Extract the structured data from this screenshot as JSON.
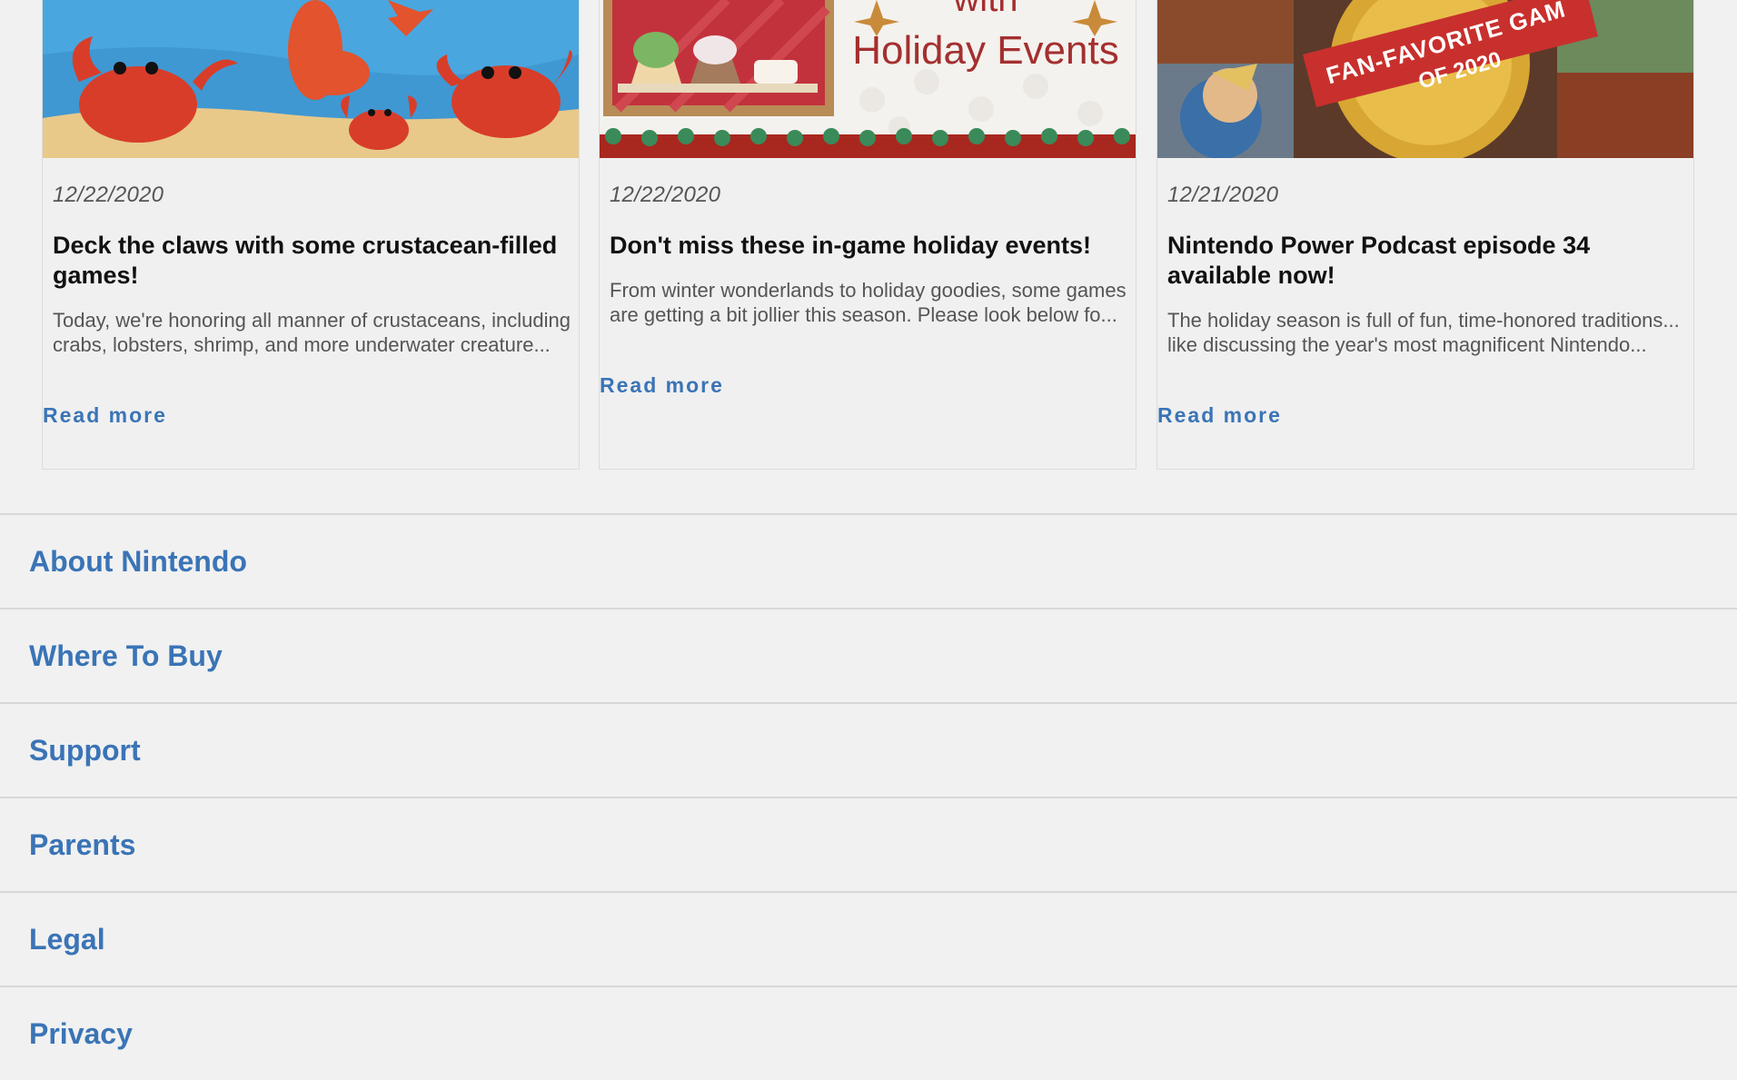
{
  "cards": [
    {
      "date": "12/22/2020",
      "title": "Deck the claws with some crustacean-filled games!",
      "description": "Today, we're honoring all manner of crustaceans, including crabs, lobsters, shrimp, and more underwater creature...",
      "read_more": "Read more"
    },
    {
      "date": "12/22/2020",
      "title": "Don't miss these in-game holiday events!",
      "description": "From winter wonderlands to holiday goodies, some games are getting a bit jollier this season. Please look below fo...",
      "read_more": "Read more",
      "image_text": [
        "with",
        "Holiday Events"
      ]
    },
    {
      "date": "12/21/2020",
      "title": "Nintendo Power Podcast episode 34 available now!",
      "description": "The holiday season is full of fun, time-honored traditions... like discussing the year's most magnificent Nintendo...",
      "read_more": "Read more",
      "image_text": [
        "FAN-FAVORITE GAM",
        "OF 2020"
      ]
    }
  ],
  "footer": {
    "items": [
      "About Nintendo",
      "Where To Buy",
      "Support",
      "Parents",
      "Legal",
      "Privacy"
    ]
  },
  "colors": {
    "link": "#3a74b6",
    "background": "#f1f1f1"
  }
}
